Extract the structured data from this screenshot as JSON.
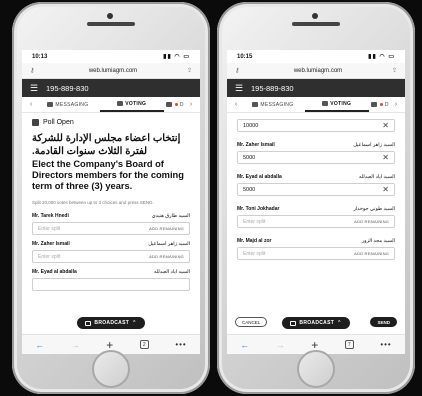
{
  "left": {
    "time": "10:13",
    "url": "web.lumiagm.com",
    "meeting_id": "195-889-830",
    "tabs": {
      "messaging": "MESSAGING",
      "voting": "VOTING",
      "partial": "D"
    },
    "poll_status": "Poll Open",
    "question_ar": "إنتخاب اعضاء مجلس الإدارة للشركة لفترة الثلاث سنوات القادمة.",
    "question_en": "Elect the Company's Board of Directors members for the coming term of three (3) years.",
    "hint": "Split 20,000 votes between up to 3 choices and press SEND.",
    "candidates": [
      {
        "name": "Mr. Tarek Hnedi",
        "name_ar": "السيد طارق هنيدي",
        "placeholder": "Enter split",
        "action": "ADD REMAINING"
      },
      {
        "name": "Mr. Zaher Ismail",
        "name_ar": "السيد زاهر اسماعيل",
        "placeholder": "Enter split",
        "action": "ADD REMAINING"
      },
      {
        "name": "Mr. Eyad al abdalla",
        "name_ar": "السيد اياد العبدلله",
        "placeholder": "",
        "action": ""
      }
    ],
    "broadcast": "BROADCAST",
    "tab_count": "2"
  },
  "right": {
    "time": "10:15",
    "url": "web.lumiagm.com",
    "meeting_id": "195-889-830",
    "tabs": {
      "messaging": "MESSAGING",
      "voting": "VOTING",
      "partial": "D"
    },
    "top_value": "10000",
    "candidates": [
      {
        "name": "Mr. Zaher Ismail",
        "name_ar": "السيد زاهر اسماعيل",
        "value": "5000",
        "placeholder": "",
        "action": ""
      },
      {
        "name": "Mr. Eyad al abdalla",
        "name_ar": "السيد اياد العبدلله",
        "value": "5000",
        "placeholder": "",
        "action": ""
      },
      {
        "name": "Mr. Toni Jokhadar",
        "name_ar": "السيد طوني جوخدار",
        "value": "",
        "placeholder": "Enter split",
        "action": "ADD REMAINING"
      },
      {
        "name": "Mr. Majd al zor",
        "name_ar": "السيد مجد الزور",
        "value": "",
        "placeholder": "Enter split",
        "action": "ADD REMAINING"
      }
    ],
    "cancel": "CANCEL",
    "broadcast": "BROADCAST",
    "send": "SEND",
    "tab_count": "7"
  }
}
